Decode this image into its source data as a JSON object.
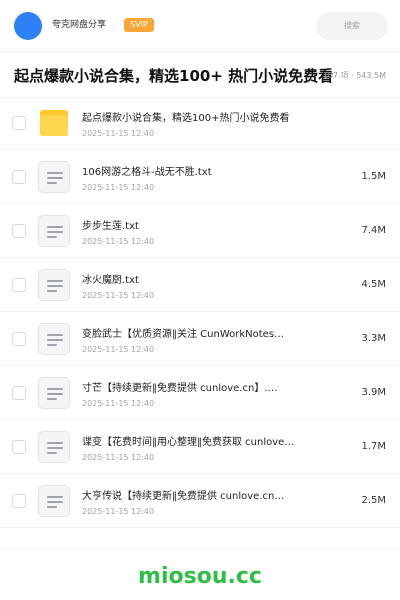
{
  "header": {
    "app_name": "夸克网盘分享",
    "badge": "SVIP",
    "search_placeholder": "搜索"
  },
  "folder": {
    "title": "起点爆款小说合集，精选100+ 热门小说免费看",
    "meta": "107 项 · 543.5M"
  },
  "files": [
    {
      "name": "起点爆款小说合集，精选100+热门小说免费看",
      "date": "2025-11-15 12:40",
      "size": "",
      "icon": "folder-icon"
    },
    {
      "name": "106网游之格斗-战无不胜.txt",
      "date": "2025-11-15 12:40",
      "size": "1.5M",
      "icon": "document-icon"
    },
    {
      "name": "步步生莲.txt",
      "date": "2025-11-15 12:40",
      "size": "7.4M",
      "icon": "document-icon"
    },
    {
      "name": "冰火魔厨.txt",
      "date": "2025-11-15 12:40",
      "size": "4.5M",
      "icon": "document-icon"
    },
    {
      "name": "变脸武士【优质资源‖关注 CunWorkNotes…",
      "date": "2025-11-15 12:40",
      "size": "3.3M",
      "icon": "document-icon"
    },
    {
      "name": "寸芒【持续更新‖免费提供 cunlove.cn】.…",
      "date": "2025-11-15 12:40",
      "size": "3.9M",
      "icon": "document-icon"
    },
    {
      "name": "谍变【花费时间‖用心整理‖免费获取 cunlove…",
      "date": "2025-11-15 12:40",
      "size": "1.7M",
      "icon": "document-icon"
    },
    {
      "name": "大亨传说【持续更新‖免费提供 cunlove.cn…",
      "date": "2025-11-15 12:40",
      "size": "2.5M",
      "icon": "document-icon"
    }
  ],
  "footer": {
    "brand": "miosou.cc"
  },
  "colors": {
    "avatar": "#2f7ff5",
    "badge": "#f7a735",
    "folder": "#ffc629",
    "brand": "#2fbf47"
  }
}
